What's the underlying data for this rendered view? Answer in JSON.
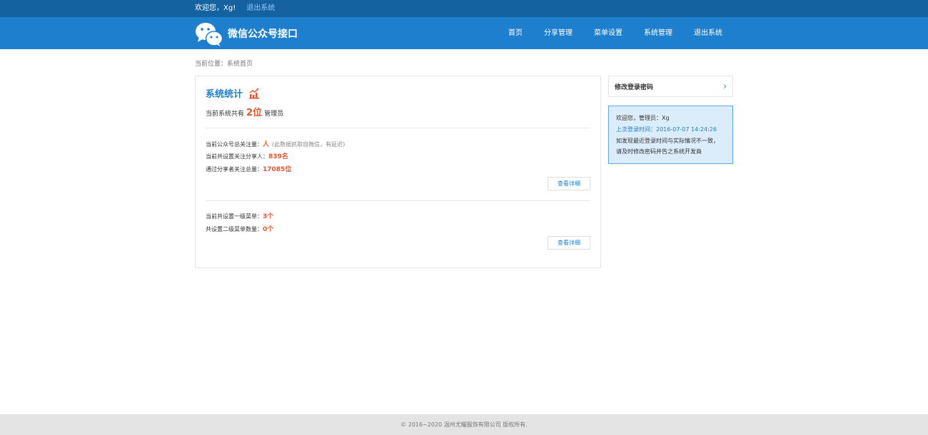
{
  "topbar": {
    "welcome": "欢迎您，Xg!",
    "logout": "退出系统"
  },
  "header": {
    "logo_icon": "wechat-logo-icon",
    "title": "微信公众号接口",
    "nav": [
      {
        "label": "首页"
      },
      {
        "label": "分享管理"
      },
      {
        "label": "菜单设置"
      },
      {
        "label": "系统管理"
      },
      {
        "label": "退出系统"
      }
    ]
  },
  "breadcrumb": "当前位置：系统首页",
  "stats": {
    "title": "系统统计",
    "title_icon": "chart-icon",
    "admin_prefix": "当前系统共有",
    "admin_count": "2位",
    "admin_suffix": "管理员",
    "followers_label": "当前公众号总关注量：",
    "followers_value": "人",
    "followers_note": "(此数据抓取自微信，有延迟)",
    "sharers_label": "当前共设置关注分享人：",
    "sharers_value": "839名",
    "shared_follow_label": "通过分享者关注总量：",
    "shared_follow_value": "17085位",
    "detail_button_1": "查看详细",
    "menu1_label": "当前共设置一级菜单：",
    "menu1_value": "3个",
    "menu2_label": "共设置二级菜单数量：",
    "menu2_value": "0个",
    "detail_button_2": "查看详细"
  },
  "sidebar": {
    "change_password": "修改登录密码",
    "chevron_icon": "chevron-right-icon",
    "welcome": "欢迎您，管理员：Xg",
    "last_login": "上次登录时间：2016-07-07 14:24:26",
    "warning_line1": "如发现最近登录时间与实际情况不一致，",
    "warning_line2": "请及时修改密码并告之系统开发商"
  },
  "footer": "© 2016~2020 温州尤耀服饰有限公司 版权所有.",
  "colors": {
    "topbar": "#14629f",
    "header": "#1d7fcd",
    "accent": "#1d7fcd",
    "highlight": "#e8542c",
    "info_bg": "#dbecfb"
  }
}
